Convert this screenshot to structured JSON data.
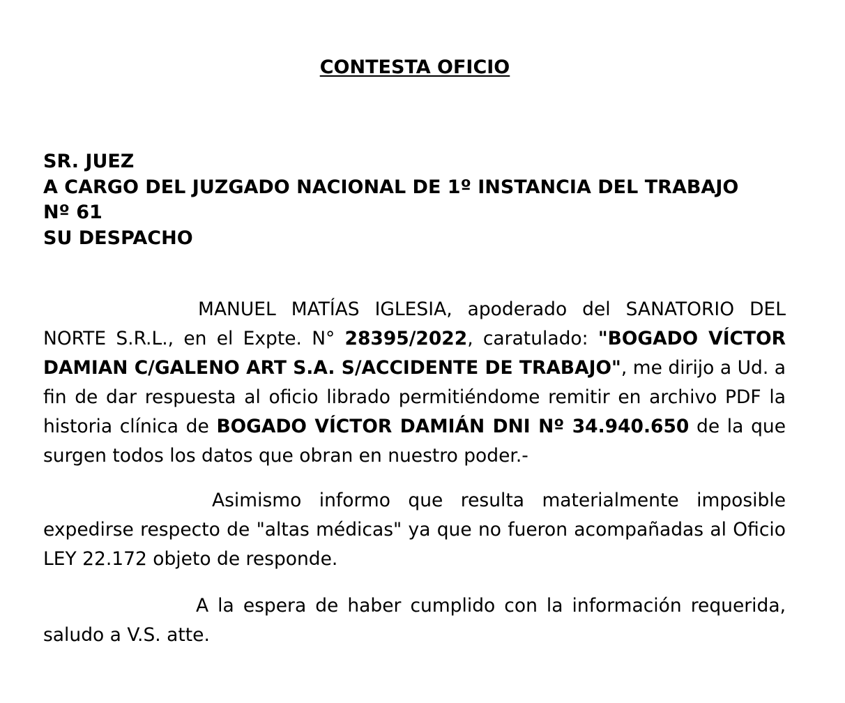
{
  "document": {
    "title": "CONTESTA OFICIO",
    "addressee": {
      "line1": "SR. JUEZ",
      "line2": "A CARGO DEL JUZGADO NACIONAL DE 1º INSTANCIA DEL TRABAJO",
      "line3": "Nº 61",
      "line4": "SU DESPACHO"
    },
    "paragraph1": {
      "intro": "MANUEL MATÍAS IGLESIA, apoderado del SANATORIO DEL NORTE S.R.L., en el Expte. N° ",
      "case_number": "28395/2022",
      "caratulado_label": ", caratulado: ",
      "case_title": "\"BOGADO VÍCTOR DAMIAN C/GALENO ART S.A. S/ACCIDENTE DE TRABAJO\"",
      "middle": ", me dirijo a Ud. a fin de dar respuesta al oficio librado  permitiéndome remitir en archivo PDF la historia clínica de ",
      "patient": "BOGADO VÍCTOR DAMIÁN DNI Nº 34.940.650",
      "ending": " de la que surgen todos los datos que obran en nuestro poder.-"
    },
    "paragraph2": {
      "text": "Asimismo informo que resulta materialmente imposible expedirse respecto de \"altas médicas\" ya que no fueron acompañadas al Oficio LEY 22.172 objeto de responde."
    },
    "paragraph3": {
      "text": "A la espera de haber cumplido con la información requerida, saludo a V.S. atte."
    }
  }
}
